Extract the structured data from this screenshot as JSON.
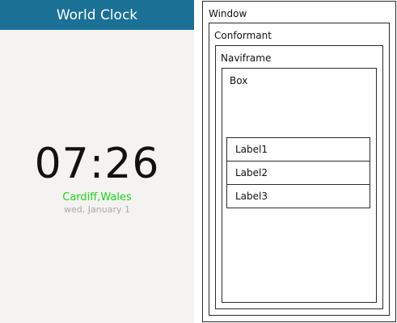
{
  "phone": {
    "header_title": "World Clock",
    "time": "07:26",
    "city": "Cardiff,Wales",
    "date": "wed, January 1",
    "colors": {
      "header_bg": "#1b7096",
      "screen_bg": "#f4f3f1",
      "city_text": "#1bd41b",
      "date_text": "#a8a8a8"
    }
  },
  "diagram": {
    "window_label": "Window",
    "conformant_label": "Conformant",
    "naviframe_label": "Naviframe",
    "box_label": "Box",
    "labels": [
      "Label1",
      "Label2",
      "Label3"
    ]
  }
}
